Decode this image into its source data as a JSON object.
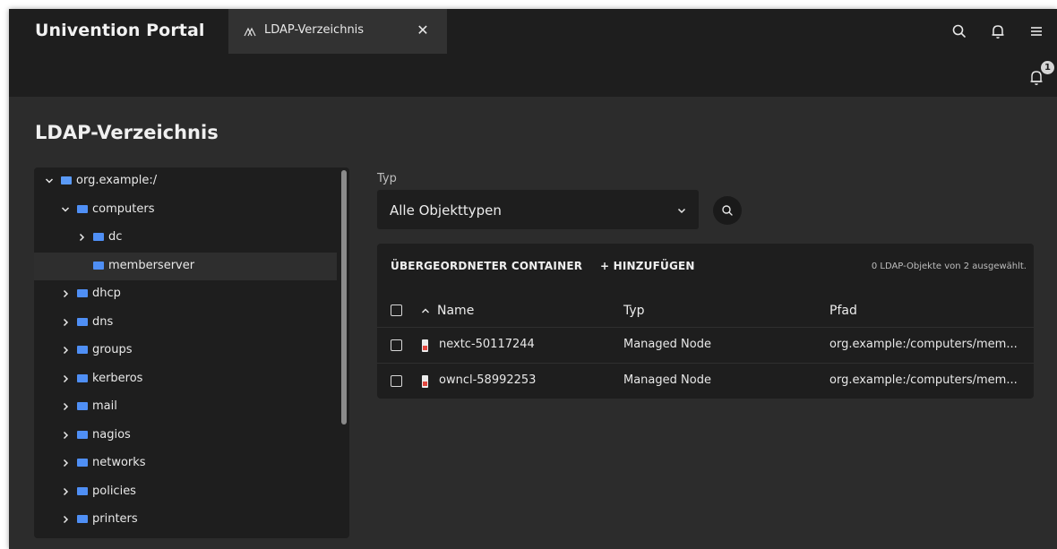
{
  "topbar": {
    "title": "Univention Portal",
    "tab": {
      "label": "LDAP-Verzeichnis",
      "icon": "univention-logo-icon",
      "close": "✕"
    },
    "icons": [
      "search-icon",
      "bell-icon",
      "menu-icon"
    ]
  },
  "subbar": {
    "notification_count": "1",
    "icon": "bell-icon"
  },
  "page": {
    "title": "LDAP-Verzeichnis"
  },
  "tree": {
    "items": [
      {
        "label": "org.example:/",
        "level": 0,
        "expanded": true,
        "has_toggle": true
      },
      {
        "label": "computers",
        "level": 1,
        "expanded": true,
        "has_toggle": true
      },
      {
        "label": "dc",
        "level": 2,
        "expanded": false,
        "has_toggle": true
      },
      {
        "label": "memberserver",
        "level": 2,
        "expanded": false,
        "has_toggle": false,
        "selected": true
      },
      {
        "label": "dhcp",
        "level": 1,
        "expanded": false,
        "has_toggle": true
      },
      {
        "label": "dns",
        "level": 1,
        "expanded": false,
        "has_toggle": true
      },
      {
        "label": "groups",
        "level": 1,
        "expanded": false,
        "has_toggle": true
      },
      {
        "label": "kerberos",
        "level": 1,
        "expanded": false,
        "has_toggle": true
      },
      {
        "label": "mail",
        "level": 1,
        "expanded": false,
        "has_toggle": true
      },
      {
        "label": "nagios",
        "level": 1,
        "expanded": false,
        "has_toggle": true
      },
      {
        "label": "networks",
        "level": 1,
        "expanded": false,
        "has_toggle": true
      },
      {
        "label": "policies",
        "level": 1,
        "expanded": false,
        "has_toggle": true
      },
      {
        "label": "printers",
        "level": 1,
        "expanded": false,
        "has_toggle": true
      }
    ]
  },
  "filter": {
    "label": "Typ",
    "selected": "Alle Objekttypen",
    "search_icon": "search-icon"
  },
  "grid": {
    "toolbar": {
      "parent_container": "ÜBERGEORDNETER CONTAINER",
      "add": "+ HINZUFÜGEN",
      "selected_count": "0 LDAP-Objekte von 2 ausgewählt."
    },
    "columns": {
      "name": "Name",
      "typ": "Typ",
      "pfad": "Pfad"
    },
    "rows": [
      {
        "name": "nextc-50117244",
        "typ": "Managed Node",
        "pfad": "org.example:/computers/mem..."
      },
      {
        "name": "owncl-58992253",
        "typ": "Managed Node",
        "pfad": "org.example:/computers/mem..."
      }
    ]
  },
  "colors": {
    "background": "#2c2c2c",
    "bar": "#1e1e1e",
    "folder": "#4f8ff5",
    "node_accent": "#e2473f"
  }
}
